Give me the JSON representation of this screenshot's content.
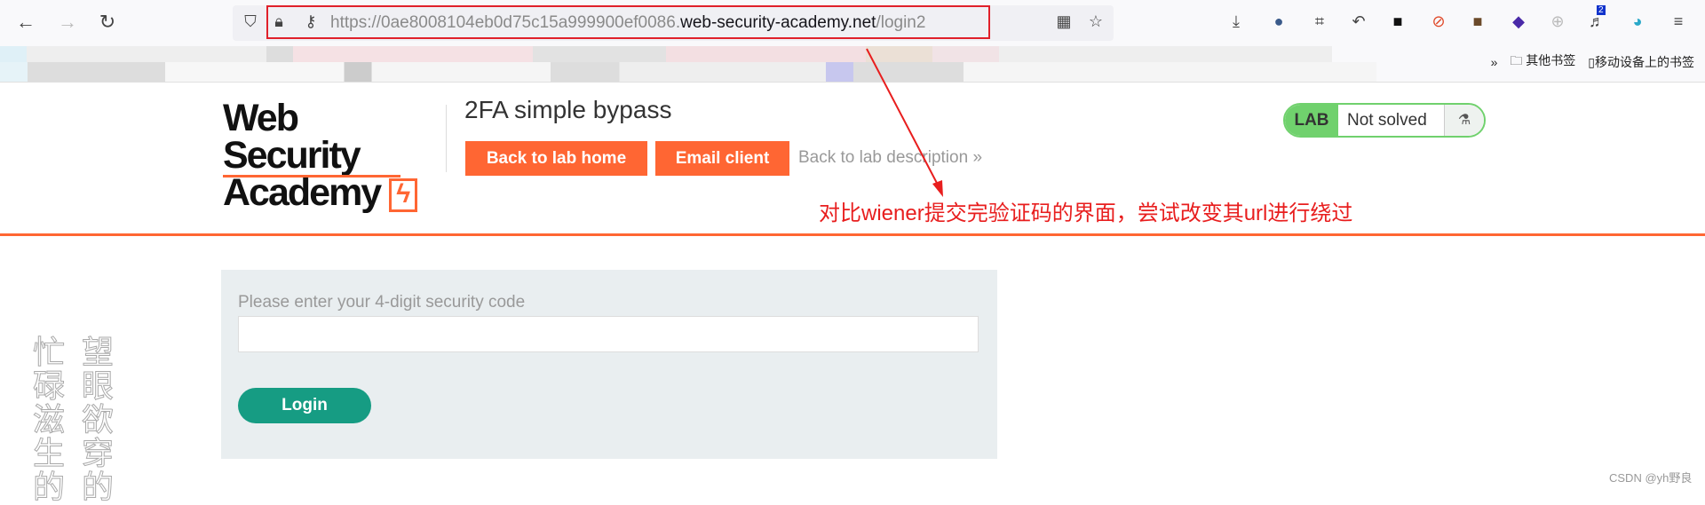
{
  "browser": {
    "url_prefix": "https://0ae8008104eb0d75c15a999900ef0086.",
    "url_domain": "web-security-academy.net",
    "url_path": "/login2",
    "icons": [
      "back-icon",
      "forward-icon",
      "reload-icon",
      "shield-icon",
      "lock-icon",
      "key-icon",
      "qr-code-icon",
      "star-icon",
      "download-icon",
      "extension-icon",
      "crop-icon",
      "undo-icon",
      "extension-icon",
      "blocked-icon",
      "avatar-icon",
      "extension-icon",
      "extension-icon",
      "extension-icon",
      "extension-icon",
      "menu-icon"
    ],
    "extension_badge": "2",
    "bookmarks": {
      "other": "其他书签",
      "mobile": "移动设备上的书签"
    }
  },
  "header": {
    "logo_line1": "Web Security",
    "logo_line2": "Academy",
    "title": "2FA simple bypass",
    "back_home": "Back to lab home",
    "email_client": "Email client",
    "back_desc": "Back to lab description",
    "lab_label": "LAB",
    "lab_status": "Not solved",
    "accent": "#ff6633"
  },
  "annotation": "对比wiener提交完验证码的界面，尝试改变其url进行绕过",
  "form": {
    "label": "Please enter your 4-digit security code",
    "value": "",
    "login": "Login"
  },
  "watermark": {
    "col1": "忙碌滋生的",
    "col2": "望眼欲穿的"
  },
  "credit": "CSDN @yh野良"
}
